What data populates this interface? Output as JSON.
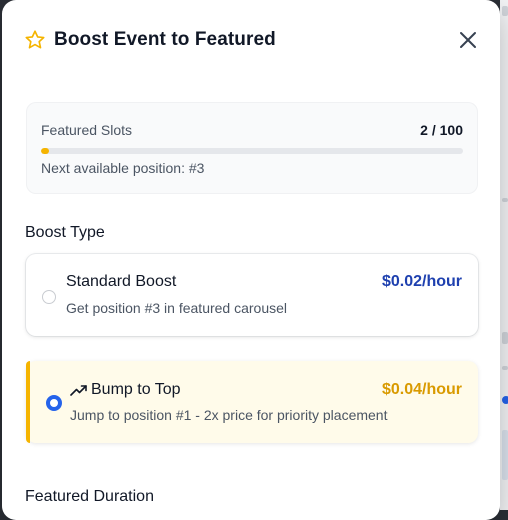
{
  "modal": {
    "title": "Boost Event to Featured",
    "icons": {
      "title_icon": "star-icon",
      "close": "close-icon"
    }
  },
  "slots": {
    "label": "Featured Slots",
    "count": "2 / 100",
    "filled_fraction": 0.02,
    "next_position": "Next available position: #3"
  },
  "boost_type": {
    "label": "Boost Type",
    "options": [
      {
        "title": "Standard Boost",
        "price": "$0.02/hour",
        "description": "Get position #3 in featured carousel",
        "selected": false
      },
      {
        "title": "Bump to Top",
        "icon": "trending-up-icon",
        "price": "$0.04/hour",
        "description": "Jump to position #1 - 2x price for priority placement",
        "selected": true
      }
    ]
  },
  "duration": {
    "label": "Featured Duration"
  },
  "colors": {
    "accent_yellow": "#f5b400",
    "standard_price": "#1e40af",
    "bump_price": "#d99a00",
    "radio_selected": "#2563eb"
  }
}
